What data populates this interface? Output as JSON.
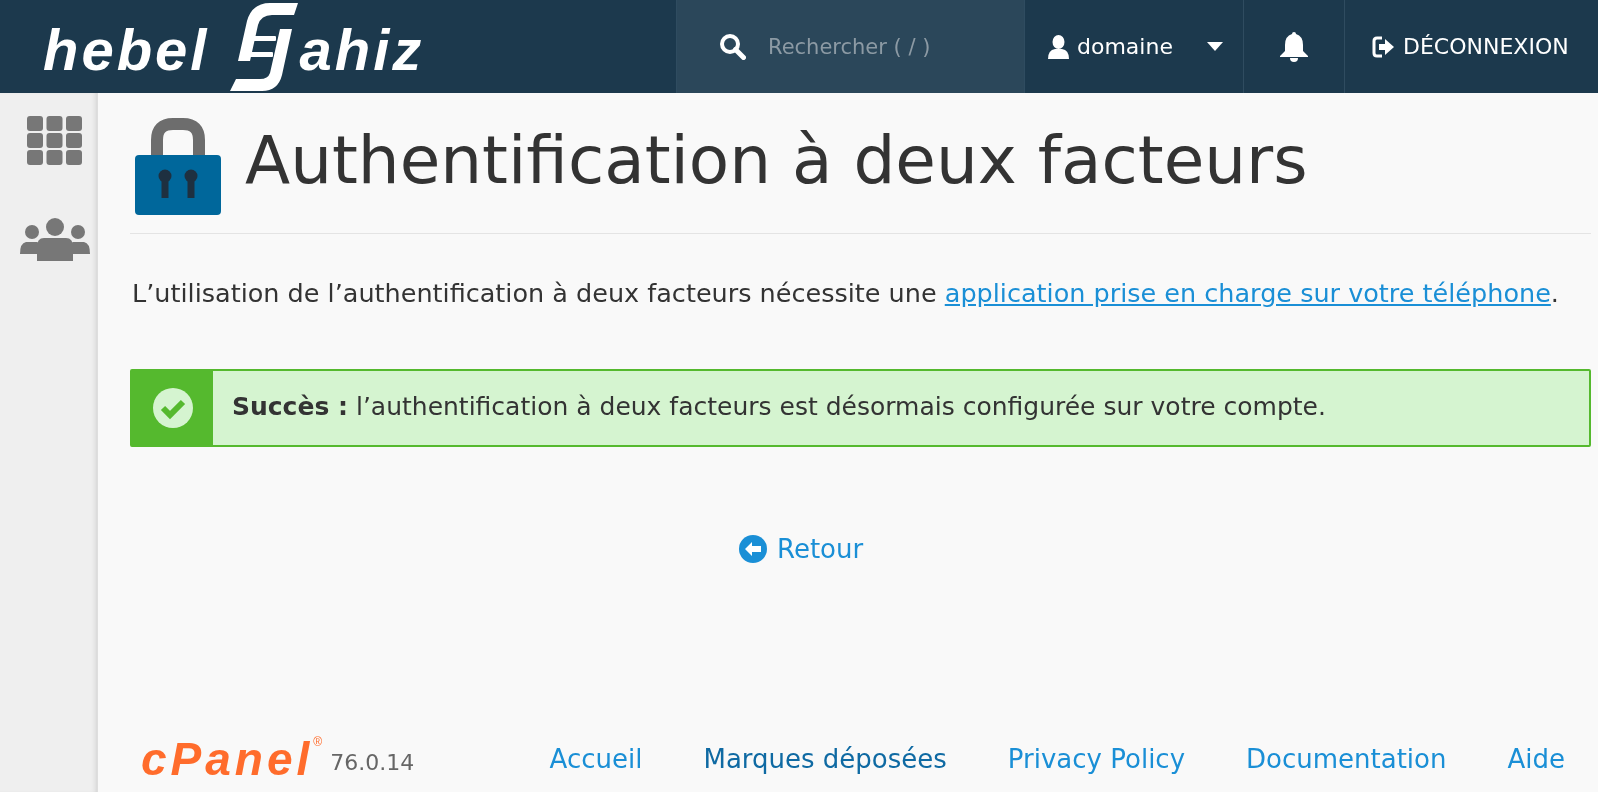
{
  "header": {
    "logo": {
      "text_left": "hebel",
      "text_right": "ahiz"
    },
    "search": {
      "placeholder": "Rechercher ( / )"
    },
    "user_menu": {
      "label": "domaine"
    },
    "logout": {
      "label": "DÉCONNEXION"
    }
  },
  "page": {
    "title": "Authentification à deux facteurs",
    "intro": {
      "text": "L’utilisation de l’authentification à deux facteurs nécessite une ",
      "link": "application prise en charge sur votre téléphone",
      "end": "."
    }
  },
  "alert": {
    "kind": "success",
    "message": "**Succès :** l’authentification à deux facteurs est désormais configurée sur votre compte."
  },
  "back_link": {
    "label": "Retour"
  },
  "footer": {
    "brand": "cPanel$^{®}$",
    "version": "76.0.14",
    "links": [
      {
        "label": "Accueil",
        "hovered": false
      },
      {
        "label": "Marques déposées",
        "hovered": true
      },
      {
        "label": "Privacy Policy",
        "hovered": false
      },
      {
        "label": "Documentation",
        "hovered": false
      },
      {
        "label": "Aide",
        "hovered": false
      }
    ]
  }
}
